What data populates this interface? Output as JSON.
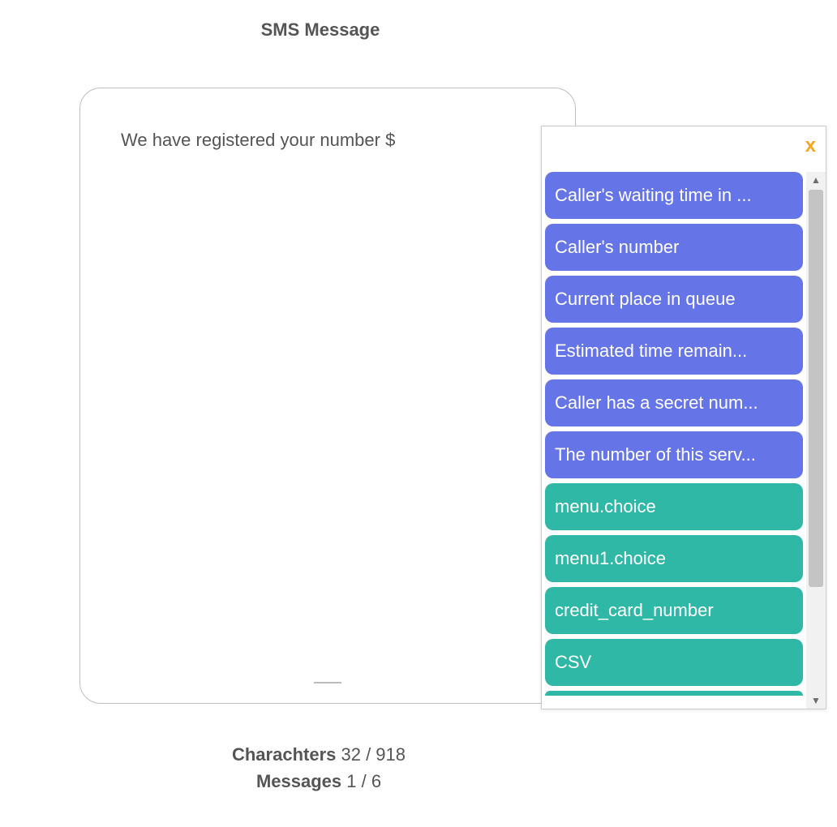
{
  "title": "SMS Message",
  "editor": {
    "text": "We have registered your number $"
  },
  "footer": {
    "chars_label": "Charachters",
    "chars_value": "32 / 918",
    "msgs_label": "Messages",
    "msgs_value": "1 / 6"
  },
  "popup": {
    "close": "x",
    "scroll_up": "▲",
    "scroll_down": "▼",
    "items": [
      {
        "label": "Caller's waiting time in ...",
        "kind": "blue"
      },
      {
        "label": "Caller's number",
        "kind": "blue"
      },
      {
        "label": "Current place in queue",
        "kind": "blue"
      },
      {
        "label": "Estimated time remain...",
        "kind": "blue"
      },
      {
        "label": "Caller has a secret num...",
        "kind": "blue"
      },
      {
        "label": "The number of this serv...",
        "kind": "blue"
      },
      {
        "label": "menu.choice",
        "kind": "teal"
      },
      {
        "label": "menu1.choice",
        "kind": "teal"
      },
      {
        "label": "credit_card_number",
        "kind": "teal"
      },
      {
        "label": "CSV",
        "kind": "teal"
      }
    ]
  }
}
